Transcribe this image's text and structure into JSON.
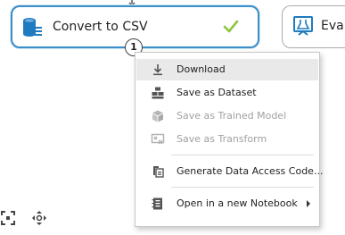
{
  "canvas": {
    "modules": [
      {
        "label": "Convert to CSV",
        "status_icon": "checkmark-icon",
        "port_number": "1"
      },
      {
        "label": "Evalu",
        "icon": "evaluate-icon"
      }
    ],
    "tools": [
      "fit-to-screen-icon",
      "pan-icon"
    ]
  },
  "context_menu": {
    "items": [
      {
        "label": "Download",
        "icon": "download-icon",
        "state": "hover"
      },
      {
        "label": "Save as Dataset",
        "icon": "dataset-icon",
        "state": "enabled"
      },
      {
        "label": "Save as Trained Model",
        "icon": "trained-model-icon",
        "state": "disabled"
      },
      {
        "label": "Save as Transform",
        "icon": "transform-icon",
        "state": "disabled"
      },
      {
        "label": "Generate Data Access Code...",
        "icon": "data-access-code-icon",
        "state": "enabled"
      },
      {
        "label": "Open in a new Notebook",
        "icon": "notebook-icon",
        "state": "enabled",
        "submenu": true
      }
    ]
  },
  "colors": {
    "accent_border": "#3b8fc7",
    "icon_blue": "#1f7bbf",
    "check_green": "#8dc63f",
    "menu_hover": "#e9e9e9",
    "disabled_text": "#a0a0a0"
  }
}
